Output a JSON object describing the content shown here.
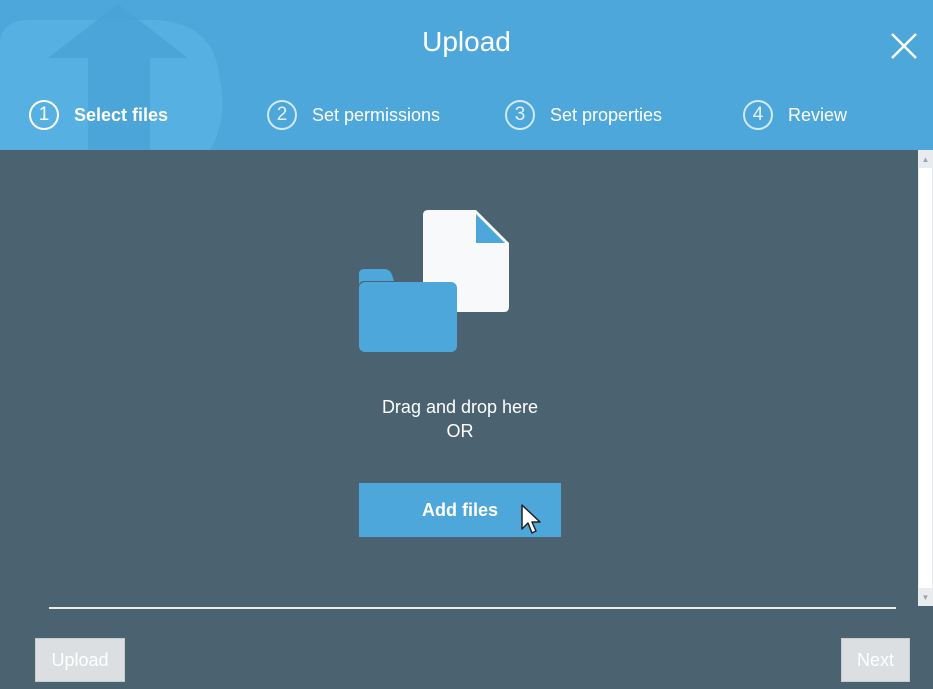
{
  "header": {
    "title": "Upload",
    "close_icon": "close-icon",
    "steps": [
      {
        "number": "1",
        "label": "Select files",
        "active": true
      },
      {
        "number": "2",
        "label": "Set permissions",
        "active": false
      },
      {
        "number": "3",
        "label": "Set properties",
        "active": false
      },
      {
        "number": "4",
        "label": "Review",
        "active": false
      }
    ]
  },
  "main": {
    "illustration_icons": [
      "folder-icon",
      "document-icon"
    ],
    "drag_text": "Drag and drop here",
    "or_text": "OR",
    "add_files_label": "Add files"
  },
  "footer": {
    "upload_label": "Upload",
    "next_label": "Next"
  },
  "colors": {
    "header_bg": "#4ea7db",
    "body_bg": "#4b6271",
    "accent": "#4ea7db",
    "disabled_button": "#dcdfe1"
  }
}
